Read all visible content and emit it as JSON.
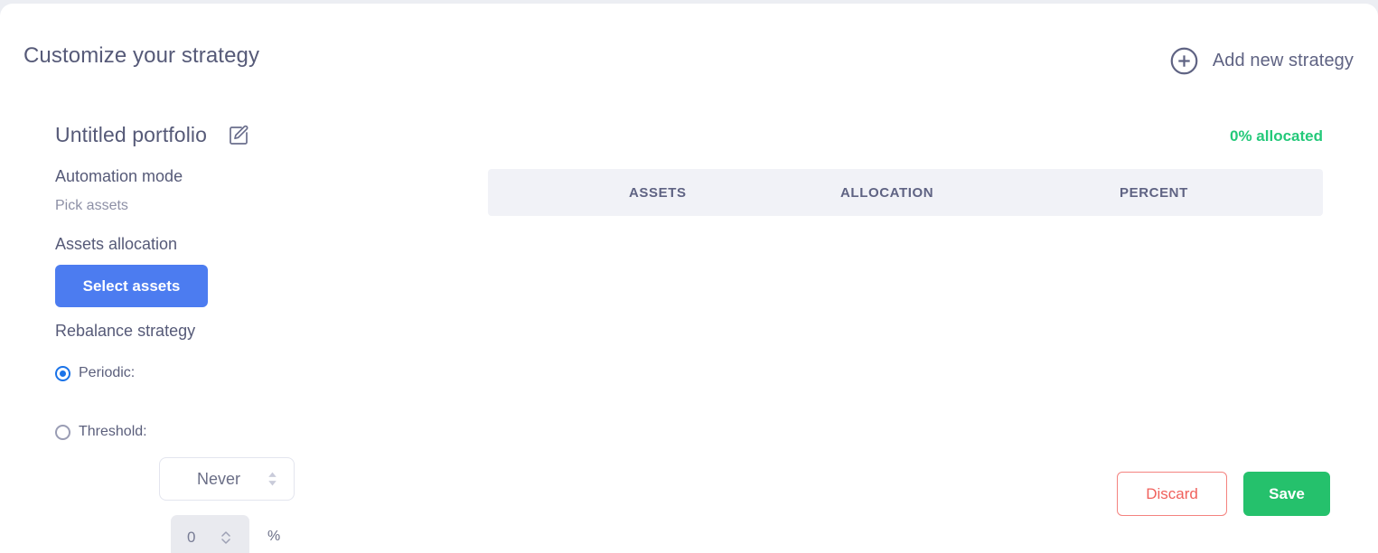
{
  "header": {
    "title": "Customize your strategy",
    "add_strategy_label": "Add new strategy",
    "add_strategy_icon": "plus-circle-icon"
  },
  "left_panel": {
    "portfolio_name": "Untitled portfolio",
    "edit_icon": "edit-pencil-icon",
    "automation": {
      "label": "Automation mode",
      "value": "Pick assets"
    },
    "allocation": {
      "label": "Assets allocation",
      "select_assets_label": "Select assets"
    },
    "rebalance": {
      "label": "Rebalance strategy",
      "periodic_label": "Periodic:",
      "periodic_selected": true,
      "periodic_value": "Never",
      "periodic_options": [
        "Never"
      ],
      "threshold_label": "Threshold:",
      "threshold_selected": false,
      "threshold_value": "0",
      "threshold_placeholder": "0",
      "percent_sign": "%"
    }
  },
  "right_panel": {
    "allocated_badge": "0% allocated",
    "table": {
      "columns": [
        "ASSETS",
        "ALLOCATION",
        "PERCENT"
      ],
      "rows": []
    }
  },
  "footer": {
    "discard_label": "Discard",
    "save_label": "Save"
  },
  "colors": {
    "accent_blue": "#4c7cf0",
    "radio_blue": "#1a73e8",
    "success_green": "#25c16c",
    "badge_green": "#24c97a",
    "danger_red": "#f0615c",
    "text_primary": "#565a78",
    "text_muted": "#8d90a6",
    "table_head_bg": "#f1f2f7",
    "page_bg": "#eceef3"
  }
}
